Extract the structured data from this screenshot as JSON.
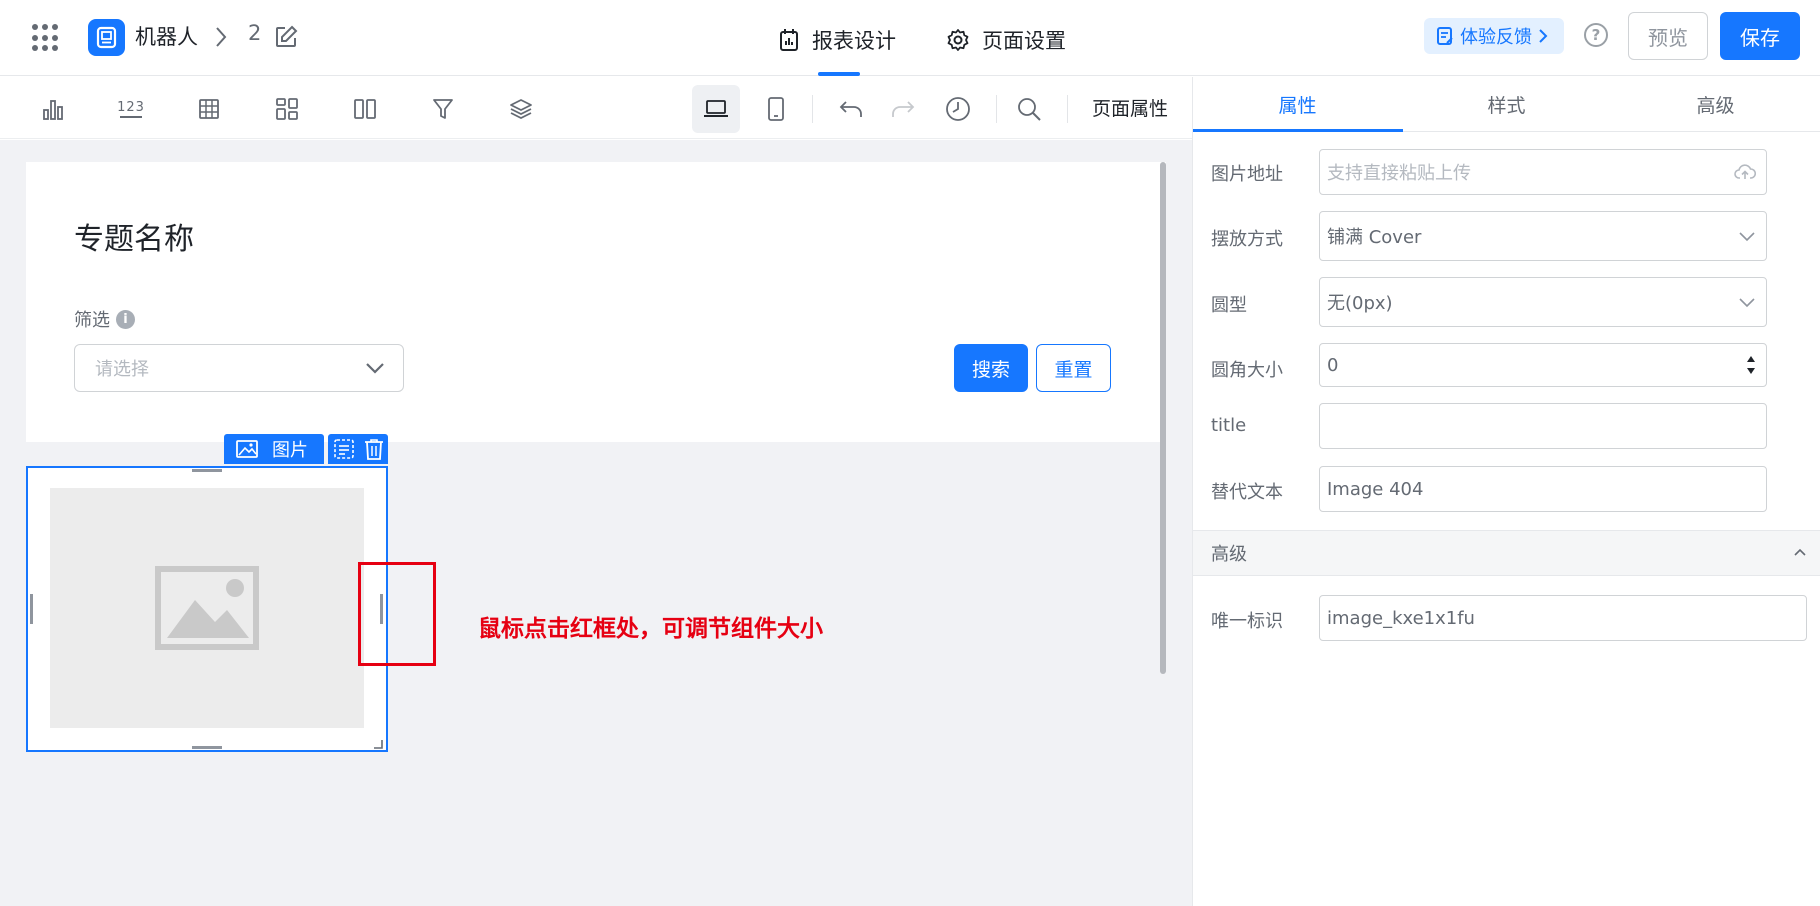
{
  "header": {
    "app_name": "机器人",
    "breadcrumb_sep": ">",
    "page_number": "2",
    "tabs": [
      {
        "label": "报表设计",
        "icon": "report-icon",
        "active": true
      },
      {
        "label": "页面设置",
        "icon": "gear-icon",
        "active": false
      }
    ],
    "feedback_label": "体验反馈",
    "help_label": "?",
    "preview_label": "预览",
    "save_label": "保存"
  },
  "toolbar": {
    "tools": [
      "bar-chart-icon",
      "number-icon",
      "table-icon",
      "grid-layout-icon",
      "columns-icon",
      "filter-icon",
      "layers-icon"
    ],
    "number_icon_text": "123",
    "devices": [
      "desktop-icon",
      "mobile-icon"
    ],
    "actions": [
      "undo-icon",
      "redo-icon",
      "history-icon",
      "search-icon"
    ],
    "page_properties_label": "页面属性"
  },
  "canvas": {
    "topic_title": "专题名称",
    "filter_label": "筛选",
    "info_glyph": "i",
    "select_placeholder": "请选择",
    "search_button": "搜索",
    "reset_button": "重置",
    "image_widget_label": "图片",
    "annotation": "鼠标点击红框处，可调节组件大小"
  },
  "panel": {
    "tabs": [
      {
        "label": "属性",
        "active": true
      },
      {
        "label": "样式",
        "active": false
      },
      {
        "label": "高级",
        "active": false
      }
    ],
    "fields": {
      "image_url_label": "图片地址",
      "image_url_placeholder": "支持直接粘贴上传",
      "fit_label": "摆放方式",
      "fit_value": "铺满 Cover",
      "shape_label": "圆型",
      "shape_value": "无(0px)",
      "radius_label": "圆角大小",
      "radius_value": "0",
      "title_label": "title",
      "title_value": "",
      "alt_label": "替代文本",
      "alt_value": "Image 404"
    },
    "advanced_section": {
      "label": "高级",
      "id_label": "唯一标识",
      "id_value": "image_kxe1x1fu"
    }
  },
  "colors": {
    "accent": "#1677ff",
    "annotation_red": "#e60012",
    "canvas_bg": "#f1f2f5"
  }
}
